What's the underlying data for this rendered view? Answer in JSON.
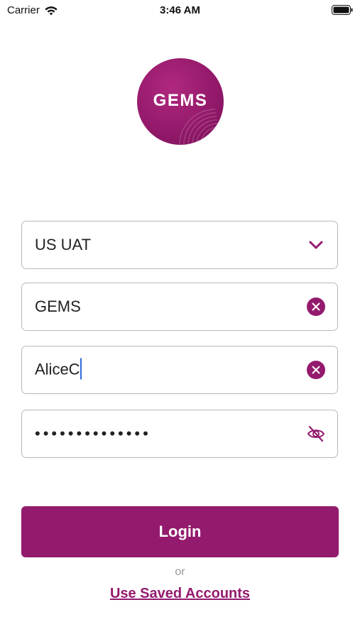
{
  "status_bar": {
    "carrier": "Carrier",
    "time": "3:46 AM",
    "wifi_icon": "wifi-icon",
    "battery_icon": "battery-icon"
  },
  "logo": {
    "text": "GEMS",
    "color": "#941a6b"
  },
  "form": {
    "environment": {
      "value": "US UAT",
      "icon": "chevron-down-icon"
    },
    "company": {
      "value": "GEMS",
      "icon": "clear-icon"
    },
    "username": {
      "value": "AliceC",
      "icon": "clear-icon"
    },
    "password": {
      "value": "••••••••••••••",
      "icon": "eye-off-icon"
    }
  },
  "actions": {
    "login_label": "Login",
    "or_label": "or",
    "saved_accounts_label": "Use Saved Accounts"
  },
  "colors": {
    "accent": "#931a6d",
    "border": "#b9b9b9",
    "caret": "#2f6ad9"
  }
}
